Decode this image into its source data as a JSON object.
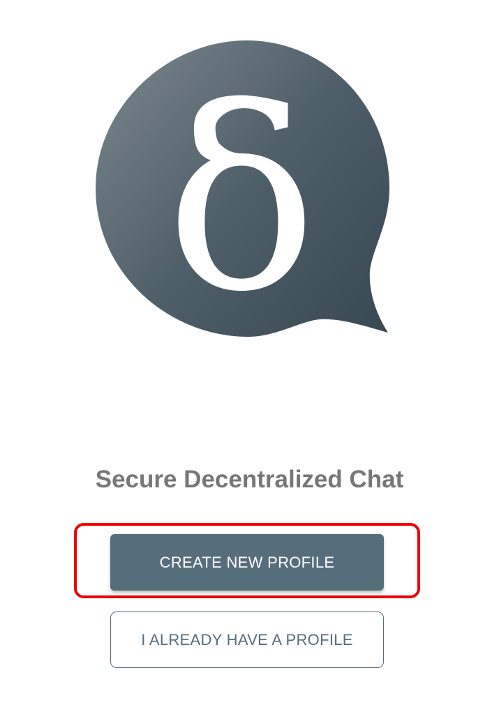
{
  "app": {
    "logo_icon": "delta-chat-bubble-icon",
    "logo_glyph": "δ",
    "tagline": "Secure Decentralized Chat"
  },
  "actions": {
    "create_label": "CREATE NEW PROFILE",
    "existing_label": "I ALREADY HAVE A PROFILE"
  },
  "colors": {
    "logo_gradient_light": "#7b878e",
    "logo_gradient_dark": "#3b4b56",
    "primary_button": "#566d7b",
    "tagline_text": "#777777",
    "highlight_border": "#f00000"
  }
}
